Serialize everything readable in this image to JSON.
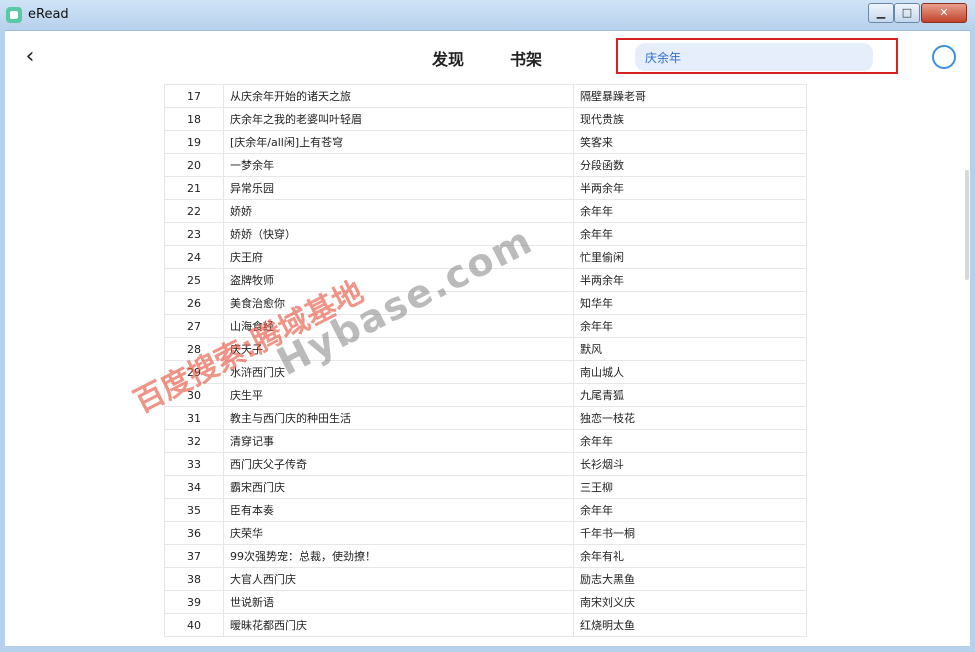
{
  "window": {
    "title": "eRead",
    "minimize_label": "▁",
    "maximize_label": "□",
    "close_label": "✕"
  },
  "nav": {
    "back_icon": "chevron-left-icon",
    "back_glyph": "‹",
    "tab_discover": "发现",
    "tab_bookshelf": "书架"
  },
  "search": {
    "value": "庆余年"
  },
  "results": [
    {
      "no": "17",
      "title": "从庆余年开始的诸天之旅",
      "author": "隔壁暴躁老哥"
    },
    {
      "no": "18",
      "title": "庆余年之我的老婆叫叶轻眉",
      "author": "现代贵族"
    },
    {
      "no": "19",
      "title": "[庆余年/all闲]上有苍穹",
      "author": "笑客来"
    },
    {
      "no": "20",
      "title": "一梦余年",
      "author": "分段函数"
    },
    {
      "no": "21",
      "title": "异常乐园",
      "author": "半两余年"
    },
    {
      "no": "22",
      "title": "娇娇",
      "author": "余年年"
    },
    {
      "no": "23",
      "title": "娇娇（快穿）",
      "author": "余年年"
    },
    {
      "no": "24",
      "title": "庆王府",
      "author": "忙里偷闲"
    },
    {
      "no": "25",
      "title": "盗牌牧师",
      "author": "半两余年"
    },
    {
      "no": "26",
      "title": "美食治愈你",
      "author": "知华年"
    },
    {
      "no": "27",
      "title": "山海食经",
      "author": "余年年"
    },
    {
      "no": "28",
      "title": "庆天子",
      "author": "默风"
    },
    {
      "no": "29",
      "title": "水浒西门庆",
      "author": "南山城人"
    },
    {
      "no": "30",
      "title": "庆生平",
      "author": "九尾青狐"
    },
    {
      "no": "31",
      "title": "教主与西门庆的种田生活",
      "author": "独恋一枝花"
    },
    {
      "no": "32",
      "title": "清穿记事",
      "author": "余年年"
    },
    {
      "no": "33",
      "title": "西门庆父子传奇",
      "author": "长衫烟斗"
    },
    {
      "no": "34",
      "title": "霸宋西门庆",
      "author": "三王柳"
    },
    {
      "no": "35",
      "title": "臣有本奏",
      "author": "余年年"
    },
    {
      "no": "36",
      "title": "庆荣华",
      "author": "千年书一桐"
    },
    {
      "no": "37",
      "title": "99次强势宠：总裁，使劲撩！",
      "author": "余年有礼"
    },
    {
      "no": "38",
      "title": "大官人西门庆",
      "author": "励志大黑鱼"
    },
    {
      "no": "39",
      "title": "世说新语",
      "author": "南宋刘义庆"
    },
    {
      "no": "40",
      "title": "暧昧花都西门庆",
      "author": "红烧明太鱼"
    }
  ],
  "watermark": {
    "text1": "百度搜索:腾域基地",
    "text2": "Hybase.com"
  },
  "colors": {
    "accent": "#3a8fe0",
    "highlight_border": "#d92020",
    "search_bg": "#e6eefb"
  }
}
